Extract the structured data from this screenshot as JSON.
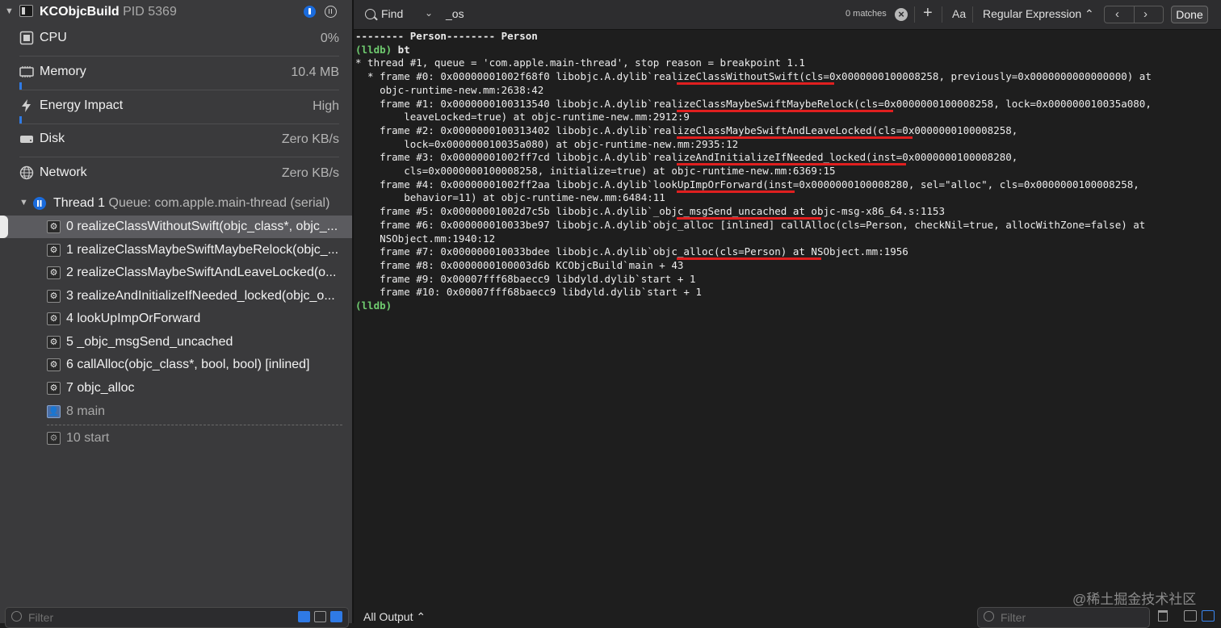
{
  "process": {
    "name": "KCObjcBuild",
    "pid": "PID 5369"
  },
  "gauges": [
    {
      "label": "CPU",
      "value": "0%",
      "level": 0.0
    },
    {
      "label": "Memory",
      "value": "10.4 MB",
      "level": 0.01
    },
    {
      "label": "Energy Impact",
      "value": "High",
      "level": 0.0
    },
    {
      "label": "Disk",
      "value": "Zero KB/s"
    },
    {
      "label": "Network",
      "value": "Zero KB/s"
    }
  ],
  "thread": {
    "title": "Thread 1",
    "queue": "Queue: com.apple.main-thread (serial)"
  },
  "frames": [
    "0 realizeClassWithoutSwift(objc_class*, objc_...",
    "1 realizeClassMaybeSwiftMaybeRelock(objc_...",
    "2 realizeClassMaybeSwiftAndLeaveLocked(o...",
    "3 realizeAndInitializeIfNeeded_locked(objc_o...",
    "4 lookUpImpOrForward",
    "5 _objc_msgSend_uncached",
    "6 callAlloc(objc_class*, bool, bool) [inlined]",
    "7 objc_alloc",
    "8 main",
    "10 start"
  ],
  "left_filter_placeholder": "Filter",
  "findbar": {
    "mode": "Find",
    "query": "_os",
    "matches": "0 matches",
    "aa": "Aa",
    "match_type": "Regular Expression",
    "done": "Done"
  },
  "console_lines": [
    "-------- Person-------- Person",
    "(lldb) bt",
    "* thread #1, queue = 'com.apple.main-thread', stop reason = breakpoint 1.1",
    "  * frame #0: 0x00000001002f68f0 libobjc.A.dylib`realizeClassWithoutSwift(cls=0x0000000100008258, previously=0x0000000000000000) at",
    "    objc-runtime-new.mm:2638:42",
    "    frame #1: 0x0000000100313540 libobjc.A.dylib`realizeClassMaybeSwiftMaybeRelock(cls=0x0000000100008258, lock=0x000000010035a080,",
    "        leaveLocked=true) at objc-runtime-new.mm:2912:9",
    "    frame #2: 0x0000000100313402 libobjc.A.dylib`realizeClassMaybeSwiftAndLeaveLocked(cls=0x0000000100008258,",
    "        lock=0x000000010035a080) at objc-runtime-new.mm:2935:12",
    "    frame #3: 0x00000001002ff7cd libobjc.A.dylib`realizeAndInitializeIfNeeded_locked(inst=0x0000000100008280,",
    "        cls=0x0000000100008258, initialize=true) at objc-runtime-new.mm:6369:15",
    "    frame #4: 0x00000001002ff2aa libobjc.A.dylib`lookUpImpOrForward(inst=0x0000000100008280, sel=\"alloc\", cls=0x0000000100008258,",
    "        behavior=11) at objc-runtime-new.mm:6484:11",
    "    frame #5: 0x00000001002d7c5b libobjc.A.dylib`_objc_msgSend_uncached at objc-msg-x86_64.s:1153",
    "    frame #6: 0x000000010033be97 libobjc.A.dylib`objc_alloc [inlined] callAlloc(cls=Person, checkNil=true, allocWithZone=false) at",
    "    NSObject.mm:1940:12",
    "    frame #7: 0x000000010033bdee libobjc.A.dylib`objc_alloc(cls=Person) at NSObject.mm:1956",
    "    frame #8: 0x0000000100003d6b KCObjcBuild`main + 43",
    "    frame #9: 0x00007fff68baecc9 libdyld.dylib`start + 1",
    "    frame #10: 0x00007fff68baecc9 libdyld.dylib`start + 1",
    "(lldb)"
  ],
  "output_selector": "All Output ⌃",
  "right_filter_placeholder": "Filter",
  "watermark": "@稀土掘金技术社区",
  "colors": {
    "accent": "#2f7ae5",
    "prompt": "#6fcb6f",
    "underline": "#e01f1f"
  }
}
